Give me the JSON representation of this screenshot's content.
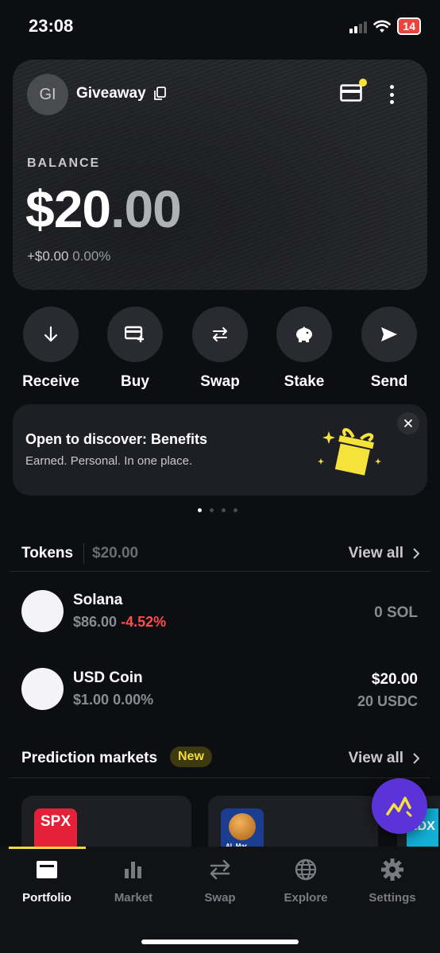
{
  "status_bar": {
    "time": "23:08",
    "battery": "14"
  },
  "account": {
    "initials": "GI",
    "name": "Giveaway"
  },
  "balance": {
    "label": "BALANCE",
    "whole": "$20",
    "cents": ".00",
    "change_value": "+$0.00",
    "change_pct": "0.00%"
  },
  "actions": [
    {
      "label": "Receive",
      "icon": "arrow-down-icon"
    },
    {
      "label": "Buy",
      "icon": "card-plus-icon"
    },
    {
      "label": "Swap",
      "icon": "swap-arrows-icon"
    },
    {
      "label": "Stake",
      "icon": "piggy-bank-icon"
    },
    {
      "label": "Send",
      "icon": "send-icon"
    }
  ],
  "banner": {
    "title": "Open to discover: Benefits",
    "subtitle": "Earned. Personal. In one place."
  },
  "tokens_section": {
    "title": "Tokens",
    "total": "$20.00",
    "view_all": "View all"
  },
  "tokens": [
    {
      "name": "Solana",
      "price": "$86.00",
      "change": "-4.52%",
      "amount": "0 SOL"
    },
    {
      "name": "USD Coin",
      "price": "$1.00",
      "change": "0.00%",
      "value": "$20.00",
      "amount": "20 USDC"
    }
  ],
  "prediction_section": {
    "title": "Prediction markets",
    "badge": "New",
    "view_all": "View all"
  },
  "markets": [
    {
      "logo_text": "SPX"
    },
    {
      "logo_text": "AL Mar"
    },
    {
      "logo_text": "NDX"
    }
  ],
  "tab_bar": [
    {
      "label": "Portfolio",
      "icon": "portfolio-icon"
    },
    {
      "label": "Market",
      "icon": "bar-chart-icon"
    },
    {
      "label": "Swap",
      "icon": "swap-arrows-icon"
    },
    {
      "label": "Explore",
      "icon": "globe-icon"
    },
    {
      "label": "Settings",
      "icon": "gear-icon"
    }
  ],
  "colors": {
    "accent_yellow": "#f3d83e",
    "negative": "#ff4d4d",
    "fab_purple": "#5b34d9"
  }
}
